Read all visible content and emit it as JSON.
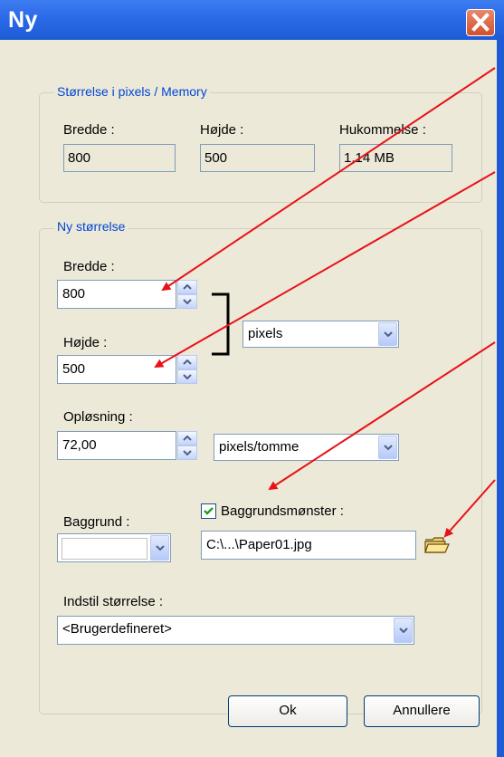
{
  "window": {
    "title": "Ny"
  },
  "size_group": {
    "legend": "Størrelse i pixels / Memory",
    "width_label": "Bredde :",
    "width_value": "800",
    "height_label": "Højde :",
    "height_value": "500",
    "memory_label": "Hukommelse :",
    "memory_value": "1,14 MB"
  },
  "new_size_group": {
    "legend": "Ny størrelse",
    "width_label": "Bredde :",
    "width_value": "800",
    "height_label": "Højde :",
    "height_value": "500",
    "unit_value": "pixels",
    "resolution_label": "Opløsning :",
    "resolution_value": "72,00",
    "resolution_unit": "pixels/tomme",
    "background_label": "Baggrund :",
    "background_color": "#ffffff",
    "pattern_checked": true,
    "pattern_label": "Baggrundsmønster :",
    "pattern_path": "C:\\...\\Paper01.jpg",
    "preset_label": "Indstil størrelse :",
    "preset_value": "<Brugerdefineret>"
  },
  "buttons": {
    "ok": "Ok",
    "cancel": "Annullere"
  },
  "colors": {
    "titlebar": "#2d6ce8",
    "dialog": "#ece9d8",
    "legend": "#0046d5",
    "arrow": "#e8111a"
  }
}
